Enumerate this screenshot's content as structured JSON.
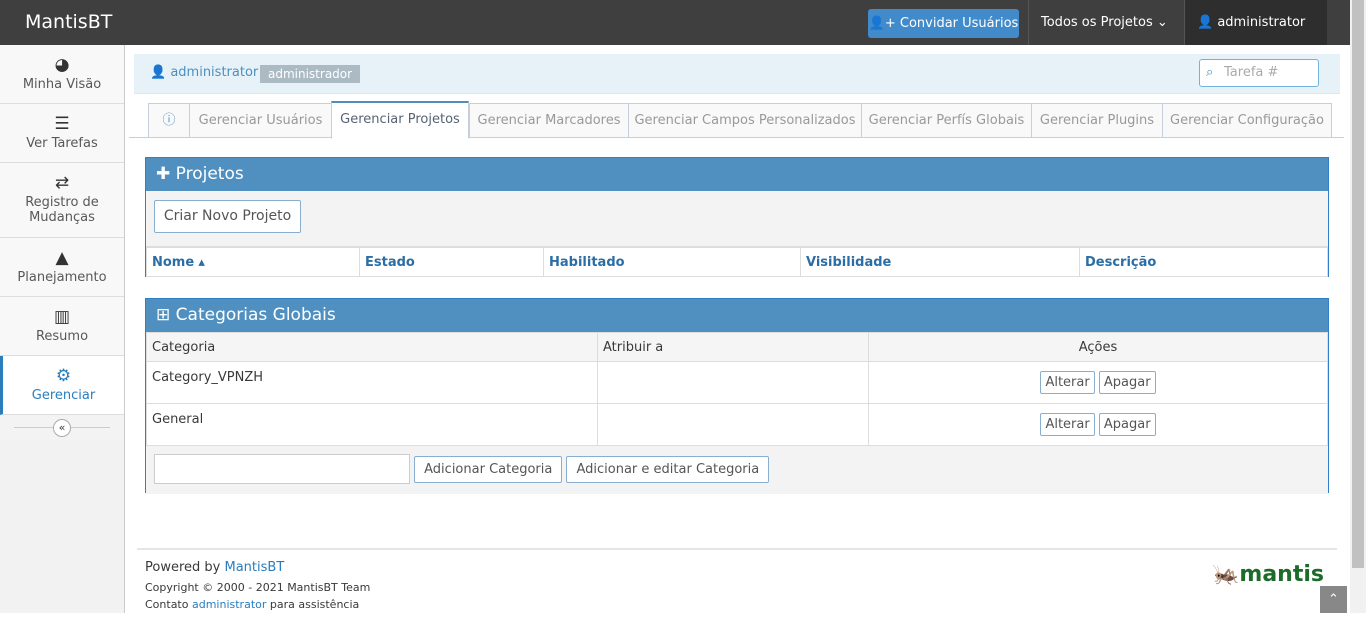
{
  "nav": {
    "brand": "MantisBT",
    "invite": "Convidar Usuários",
    "projects": "Todos os Projetos",
    "user": "administrator"
  },
  "sidebar": [
    "Minha Visão",
    "Ver Tarefas",
    "Registro de Mudanças",
    "Planejamento",
    "Resumo",
    "Gerenciar"
  ],
  "breadcrumb": {
    "user": "administrator",
    "role": "administrador"
  },
  "search": {
    "placeholder": "Tarefa #"
  },
  "tabs": [
    "Gerenciar Usuários",
    "Gerenciar Projetos",
    "Gerenciar Marcadores",
    "Gerenciar Campos Personalizados",
    "Gerenciar Perfís Globais",
    "Gerenciar Plugins",
    "Gerenciar Configuração"
  ],
  "projects": {
    "title": "Projetos",
    "create": "Criar Novo Projeto",
    "columns": [
      "Nome",
      "Estado",
      "Habilitado",
      "Visibilidade",
      "Descrição"
    ]
  },
  "categories": {
    "title": "Categorias Globais",
    "columns": [
      "Categoria",
      "Atribuir a",
      "Ações"
    ],
    "rows": [
      {
        "name": "Category_VPNZH",
        "assign": "",
        "edit": "Alterar",
        "del": "Apagar"
      },
      {
        "name": "General",
        "assign": "",
        "edit": "Alterar",
        "del": "Apagar"
      }
    ],
    "add": "Adicionar Categoria",
    "add_edit": "Adicionar e editar Categoria"
  },
  "footer": {
    "powered": "Powered by",
    "mantis": "MantisBT",
    "copyright": "Copyright © 2000 - 2021 MantisBT Team",
    "contact_pre": "Contato",
    "contact_user": "administrator",
    "contact_post": "para assistência",
    "logo": "mantis BUG TRACKER"
  }
}
